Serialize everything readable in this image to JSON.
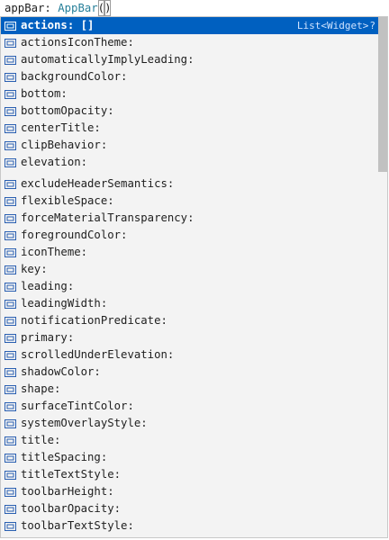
{
  "editor": {
    "property": "appBar",
    "separator": ": ",
    "type_name": "AppBar",
    "open_paren": "(",
    "close_paren": ")"
  },
  "suggest": {
    "selected_detail": "List<Widget>",
    "detail_chevron": "?",
    "icon_name": "field-icon",
    "icon_color": "#2a5fb1",
    "selected_bg": "#0060c0",
    "items": [
      {
        "label": "actions: []"
      },
      {
        "label": "actionsIconTheme:"
      },
      {
        "label": "automaticallyImplyLeading:"
      },
      {
        "label": "backgroundColor:"
      },
      {
        "label": "bottom:"
      },
      {
        "label": "bottomOpacity:"
      },
      {
        "label": "centerTitle:"
      },
      {
        "label": "clipBehavior:"
      },
      {
        "label": "elevation:"
      },
      {
        "label": "excludeHeaderSemantics:"
      },
      {
        "label": "flexibleSpace:"
      },
      {
        "label": "forceMaterialTransparency:"
      },
      {
        "label": "foregroundColor:"
      },
      {
        "label": "iconTheme:"
      },
      {
        "label": "key:"
      },
      {
        "label": "leading:"
      },
      {
        "label": "leadingWidth:"
      },
      {
        "label": "notificationPredicate:"
      },
      {
        "label": "primary:"
      },
      {
        "label": "scrolledUnderElevation:"
      },
      {
        "label": "shadowColor:"
      },
      {
        "label": "shape:"
      },
      {
        "label": "surfaceTintColor:"
      },
      {
        "label": "systemOverlayStyle:"
      },
      {
        "label": "title:"
      },
      {
        "label": "titleSpacing:"
      },
      {
        "label": "titleTextStyle:"
      },
      {
        "label": "toolbarHeight:"
      },
      {
        "label": "toolbarOpacity:"
      },
      {
        "label": "toolbarTextStyle:"
      }
    ]
  }
}
